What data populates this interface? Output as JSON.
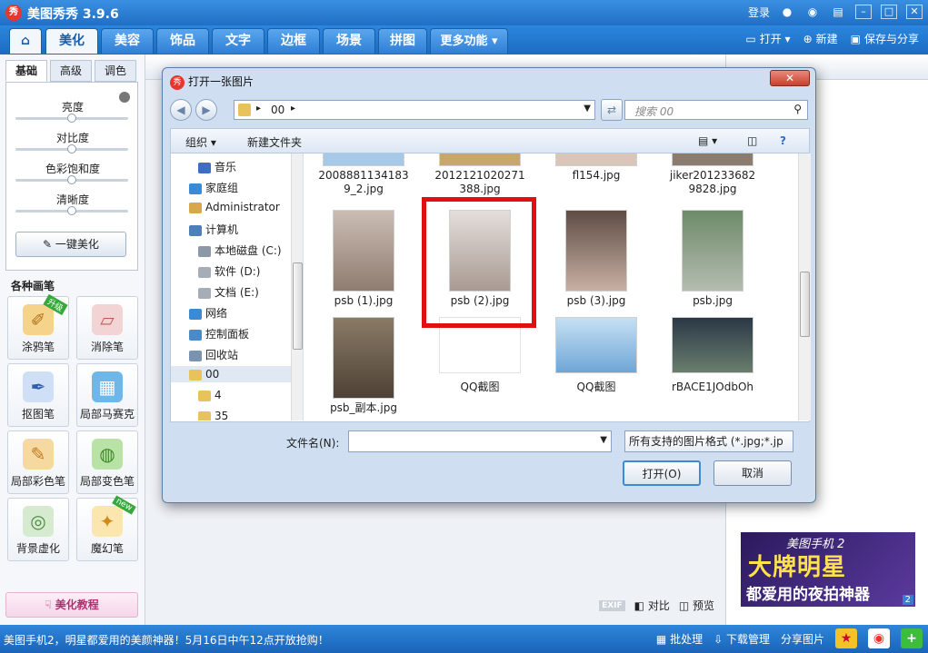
{
  "app": {
    "title": "美图秀秀 3.9.6",
    "logo_text": "秀",
    "login": "登录"
  },
  "tabs": [
    "美化",
    "美容",
    "饰品",
    "文字",
    "边框",
    "场景",
    "拼图",
    "更多功能 ▾"
  ],
  "top_actions": {
    "open": "打开",
    "new": "新建",
    "save_share": "保存与分享"
  },
  "left": {
    "subtabs": [
      "基础",
      "高级",
      "调色"
    ],
    "sliders": [
      {
        "label": "亮度",
        "value": 0.5
      },
      {
        "label": "对比度",
        "value": 0.5
      },
      {
        "label": "色彩饱和度",
        "value": 0.5
      },
      {
        "label": "清晰度",
        "value": 0.5
      }
    ],
    "one_key": "一键美化",
    "section_title": "各种画笔",
    "tools": [
      {
        "label": "涂鸦笔",
        "badge": "升级"
      },
      {
        "label": "消除笔",
        "badge": ""
      },
      {
        "label": "抠图笔",
        "badge": ""
      },
      {
        "label": "局部马赛克",
        "badge": ""
      },
      {
        "label": "局部彩色笔",
        "badge": ""
      },
      {
        "label": "局部变色笔",
        "badge": ""
      },
      {
        "label": "背景虚化",
        "badge": ""
      },
      {
        "label": "魔幻笔",
        "badge": "new"
      }
    ],
    "tutorial": "美化教程"
  },
  "canvas": {
    "exif": "EXIF",
    "compare": "对比",
    "preview": "预览"
  },
  "ad": {
    "top": "美图手机 2",
    "big": "大牌明星",
    "sub": "都爱用的夜拍神器",
    "page": "2"
  },
  "status": {
    "text": "美图手机2，明星都爱用的美颜神器！5月16日中午12点开放抢购！",
    "batch": "批处理",
    "download": "下载管理",
    "share": "分享图片"
  },
  "dialog": {
    "title": "打开一张图片",
    "logo_text": "秀",
    "address": "00",
    "search_placeholder": "搜索 00",
    "organize": "组织 ▾",
    "new_folder": "新建文件夹",
    "tree": [
      {
        "label": "音乐",
        "color": "#3b6fc4",
        "indent": 1
      },
      {
        "label": "家庭组",
        "color": "#3a8ad6",
        "indent": 0
      },
      {
        "label": "Administrator",
        "color": "#d7a84a",
        "indent": 0
      },
      {
        "label": "计算机",
        "color": "#4f7fb8",
        "indent": 0
      },
      {
        "label": "本地磁盘 (C:)",
        "color": "#8c98a6",
        "indent": 1
      },
      {
        "label": "软件 (D:)",
        "color": "#a6adb6",
        "indent": 1
      },
      {
        "label": "文档 (E:)",
        "color": "#a6adb6",
        "indent": 1
      },
      {
        "label": "网络",
        "color": "#3a8ad6",
        "indent": 0
      },
      {
        "label": "控制面板",
        "color": "#4a8ac8",
        "indent": 0
      },
      {
        "label": "回收站",
        "color": "#7a94b0",
        "indent": 0
      },
      {
        "label": "00",
        "color": "#e8c25a",
        "indent": 0,
        "selected": true
      },
      {
        "label": "4",
        "color": "#e8c25a",
        "indent": 1
      },
      {
        "label": "35",
        "color": "#e8c25a",
        "indent": 1
      }
    ],
    "files": [
      {
        "name": "2008881134183\n9_2.jpg",
        "color": "#a7c9e8"
      },
      {
        "name": "2012121020271\n388.jpg",
        "color": "#c7a86a"
      },
      {
        "name": "fl154.jpg",
        "color": "#d9c6b8"
      },
      {
        "name": "jiker201233682\n9828.jpg",
        "color": "#8a7c6e"
      },
      {
        "name": "psb (1).jpg",
        "color": "#b6a8a0"
      },
      {
        "name": "psb (2).jpg",
        "color": "#c8bcb6"
      },
      {
        "name": "psb (3).jpg",
        "color": "#7b6a62"
      },
      {
        "name": "psb.jpg",
        "color": "#8f9c88"
      },
      {
        "name": "psb_副本.jpg",
        "color": "#7a6a58"
      },
      {
        "name": "QQ截图",
        "color": "#ffffff"
      },
      {
        "name": "QQ截图",
        "color": "#9fc5e6"
      },
      {
        "name": "rBACE1JOdbOh",
        "color": "#3c4a5a"
      }
    ],
    "filename_label": "文件名(N):",
    "filename_value": "",
    "filetype": "所有支持的图片格式 (*.jpg;*.jp",
    "open_button": "打开(O)",
    "cancel_button": "取消"
  },
  "colors": {
    "accent": "#1f6fc6",
    "highlight": "#e01010"
  }
}
